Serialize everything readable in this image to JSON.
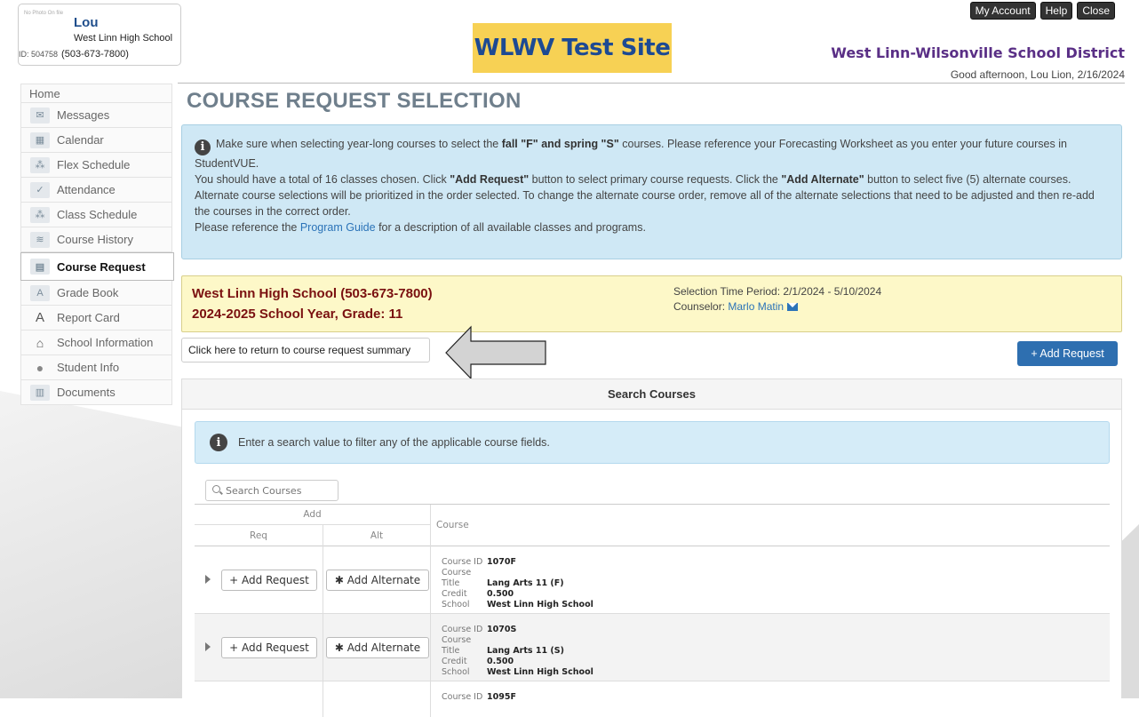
{
  "student": {
    "photo_text": "No Photo On file",
    "name": "Lou",
    "school": "West Linn High School",
    "id": "ID: 504758",
    "phone": "(503-673-7800)"
  },
  "site_logo": "WLWV Test Site",
  "top_buttons": [
    "My Account",
    "Help",
    "Close"
  ],
  "district": "West Linn-Wilsonville School District",
  "greeting": "Good afternoon, Lou Lion, 2/16/2024",
  "sidebar": {
    "home": "Home",
    "items": [
      {
        "label": "Messages",
        "icon": "messages-icon"
      },
      {
        "label": "Calendar",
        "icon": "calendar-icon"
      },
      {
        "label": "Flex Schedule",
        "icon": "flex-schedule-icon"
      },
      {
        "label": "Attendance",
        "icon": "attendance-icon"
      },
      {
        "label": "Class Schedule",
        "icon": "class-schedule-icon"
      },
      {
        "label": "Course History",
        "icon": "course-history-icon"
      },
      {
        "label": "Course Request",
        "icon": "course-request-icon",
        "active": true
      },
      {
        "label": "Grade Book",
        "icon": "grade-book-icon"
      },
      {
        "label": "Report Card",
        "icon": "report-card-icon"
      },
      {
        "label": "School Information",
        "icon": "school-information-icon"
      },
      {
        "label": "Student Info",
        "icon": "student-info-icon"
      },
      {
        "label": "Documents",
        "icon": "documents-icon"
      }
    ]
  },
  "page_title": "COURSE REQUEST SELECTION",
  "info": {
    "line1_pre": "Make sure when selecting year-long courses to select the ",
    "line1_bold": "fall \"F\" and spring \"S\"",
    "line1_post": " courses. Please reference your Forecasting Worksheet as you enter your future courses in StudentVUE.",
    "line2_pre": "You should have a total of 16 classes chosen. Click ",
    "line2_bold1": "\"Add Request\"",
    "line2_mid": " button to select primary course requests. Click the ",
    "line2_bold2": "\"Add Alternate\"",
    "line2_post": " button to select five (5) alternate courses. Alternate course selections will be prioritized in the order selected. To change the alternate course order, remove all of the alternate selections that need to be adjusted and then re-add the courses in the correct order.",
    "line3_pre": "Please reference the ",
    "line3_link": "Program Guide",
    "line3_post": " for a description of all available classes and programs."
  },
  "school_box": {
    "school": "West Linn High School (503-673-7800)",
    "year": "2024-2025 School Year, Grade: 11",
    "period": "Selection Time Period: 2/1/2024 - 5/10/2024",
    "counselor_label": "Counselor: ",
    "counselor_name": "Marlo Matin"
  },
  "return_button": "Click here to return to course request summary",
  "add_request_button": "+ Add Request",
  "search": {
    "header": "Search Courses",
    "hint": "Enter a search value to filter any of the applicable course fields.",
    "placeholder": "Search Courses"
  },
  "table": {
    "header_add": "Add",
    "header_req": "Req",
    "header_alt": "Alt",
    "header_course": "Course",
    "btn_request": "+ Add Request",
    "btn_alternate": "✱ Add Alternate",
    "labels": {
      "id": "Course ID",
      "title": "Course Title",
      "credit": "Credit",
      "school": "School"
    },
    "rows": [
      {
        "id": "1070F",
        "title": "Lang Arts 11 (F)",
        "credit": "0.500",
        "school": "West Linn High School"
      },
      {
        "id": "1070S",
        "title": "Lang Arts 11 (S)",
        "credit": "0.500",
        "school": "West Linn High School"
      },
      {
        "id": "1095F"
      }
    ]
  }
}
